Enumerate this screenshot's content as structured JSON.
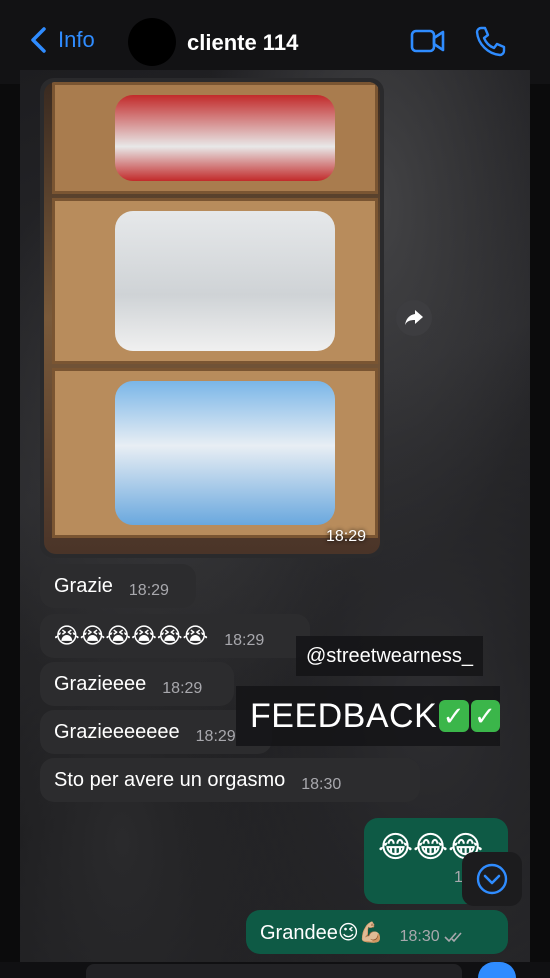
{
  "header": {
    "back_label": "Info",
    "contact_name": "cliente 114"
  },
  "photo_message": {
    "time": "18:29"
  },
  "messages": [
    {
      "text": "Grazie",
      "time": "18:29"
    },
    {
      "text": "😭😭😭😭😭😭",
      "time": "18:29"
    },
    {
      "text": "Grazieeee",
      "time": "18:29"
    },
    {
      "text": "Grazieeeeeee",
      "time": "18:29"
    },
    {
      "text": "Sto per avere un orgasmo",
      "time": "18:30"
    },
    {
      "text": "😂😂😂",
      "time": "18:30"
    },
    {
      "text": "Grandee😉💪🏼",
      "time": "18:30"
    }
  ],
  "overlay": {
    "handle": "@streetwearness_",
    "feedback": "FEEDBACK"
  },
  "colors": {
    "accent": "#2f8cff",
    "bubble_in": "#2c2c2e",
    "bubble_out": "#0e5a45"
  }
}
